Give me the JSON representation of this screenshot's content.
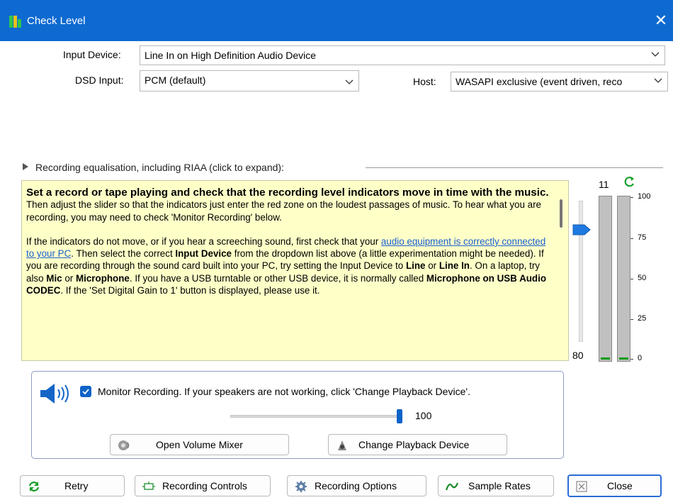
{
  "window": {
    "title": "Check Level",
    "close_glyph": "✕"
  },
  "input_device": {
    "label": "Input Device:",
    "value": "Line In on High Definition Audio Device"
  },
  "dsd_input": {
    "label": "DSD Input:",
    "value": "PCM (default)"
  },
  "host": {
    "label": "Host:",
    "value": "WASAPI exclusive (event driven, reco"
  },
  "equalisation": {
    "label": "Recording equalisation, including RIAA (click to expand):"
  },
  "info": {
    "p1_bold": "Set a record or tape playing and check that the recording level indicators move in time with the music.",
    "p1_rest": " Then adjust the slider so that the indicators just enter the red zone on the loudest passages of music.  To hear what you are recording, you may need to check 'Monitor Recording' below.",
    "p2_a": "If the indicators do not move, or if you hear a screeching sound, first check that your ",
    "p2_link": "audio equipment is correctly connected to your PC",
    "p2_b": ".  Then select the correct ",
    "p2_input_device": "Input Device",
    "p2_c": " from the dropdown list above (a little experimentation might be needed).  If you are recording through the sound card built into your PC, try setting the Input Device to ",
    "p2_line": "Line",
    "p2_or1": " or ",
    "p2_line_in": "Line In",
    "p2_d": ".  On a laptop, try also ",
    "p2_mic": "Mic",
    "p2_or2": " or ",
    "p2_microphone": "Microphone",
    "p2_e": ".  If you have a USB turntable or other USB device, it is normally called ",
    "p2_usb": "Microphone on USB Audio CODEC",
    "p2_f": ".  If the 'Set Digital Gain to 1' button is displayed, please use it."
  },
  "levels": {
    "peak_value": "11",
    "gain_value": "80",
    "gain_level": 0.8,
    "meter_left_level": 0.01,
    "meter_right_level": 0.01,
    "scale": [
      "100",
      "75",
      "50",
      "25",
      "0"
    ],
    "reset_icon": "green-refresh-arrow"
  },
  "monitor": {
    "checked": true,
    "text": "Monitor Recording.  If your speakers are not working, click 'Change Playback Device'.",
    "volume_value": "100",
    "volume_level": 1.0
  },
  "buttons": {
    "open_volume_mixer": "Open Volume Mixer",
    "change_playback_device": "Change Playback Device",
    "retry": "Retry",
    "recording_controls": "Recording Controls",
    "recording_options": "Recording Options",
    "sample_rates": "Sample Rates",
    "close": "Close"
  },
  "colors": {
    "titlebar": "#0e6ad1",
    "info_background": "#ffffc8",
    "accent": "#0e63c7",
    "meter_green": "#0a9a14"
  }
}
